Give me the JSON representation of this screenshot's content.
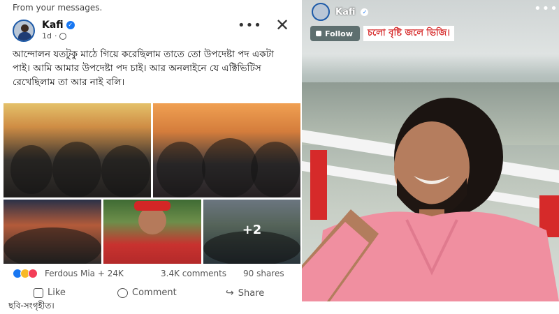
{
  "post": {
    "context": "From your messages.",
    "author": "Kafi",
    "time": "1d",
    "text": "আন্দোলন যতটুকু মাঠে গিয়ে করেছিলাম তাতে তো উপদেষ্টা পদ একটা পাই। আমি আমার উপদেষ্টা পদ চাই। আর অনলাইনে যে এক্টিভিটিস রেখেছিলাম তা আর নাই বলি।",
    "more_photos": "+2",
    "reactors": "Ferdous Mia + 24K",
    "comments": "3.4K comments",
    "shares": "90 shares",
    "actions": {
      "like": "Like",
      "comment": "Comment",
      "share": "Share"
    }
  },
  "caption": "ছবি-সংগৃহীত।",
  "story": {
    "author": "Kafi",
    "follow_label": "Follow",
    "text": "চলো বৃষ্টি জলে ভিজি।"
  },
  "colors": {
    "facebook_blue": "#1877f2",
    "story_text_red": "#d62a2a",
    "shirt_pink": "#f08fa0"
  }
}
